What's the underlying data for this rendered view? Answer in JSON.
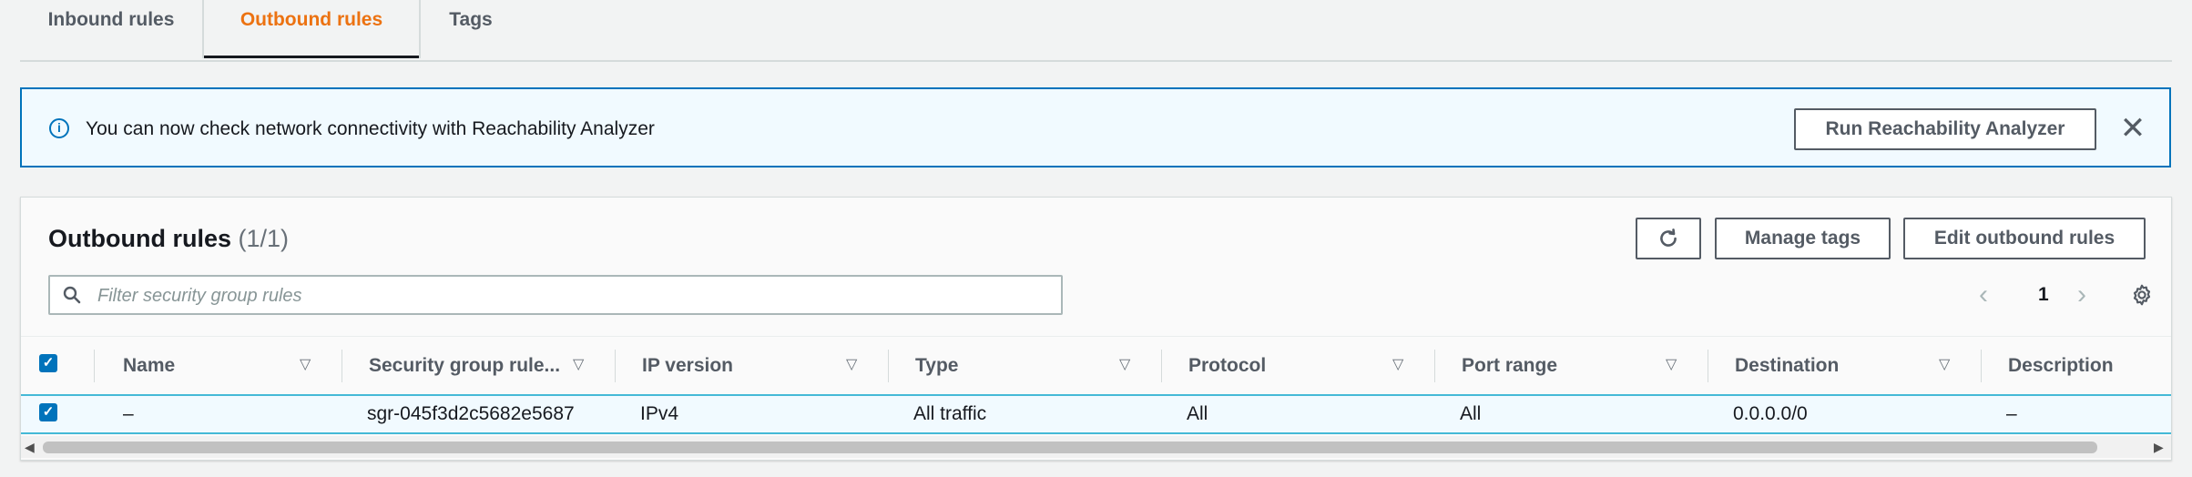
{
  "tabs": [
    {
      "label": "Inbound rules",
      "active": false
    },
    {
      "label": "Outbound rules",
      "active": true
    },
    {
      "label": "Tags",
      "active": false
    }
  ],
  "banner": {
    "icon": "info-icon",
    "text": "You can now check network connectivity with Reachability Analyzer",
    "button_label": "Run Reachability Analyzer",
    "close_glyph": "✕"
  },
  "panel": {
    "title": "Outbound rules",
    "count": "(1/1)",
    "refresh_icon": "refresh-icon",
    "manage_tags_label": "Manage tags",
    "edit_label": "Edit outbound rules",
    "search_placeholder": "Filter security group rules",
    "search_value": "",
    "page_current": "1"
  },
  "table": {
    "columns": [
      "Name",
      "Security group rule...",
      "IP version",
      "Type",
      "Protocol",
      "Port range",
      "Destination",
      "Description"
    ],
    "rows": [
      {
        "selected": true,
        "cells": [
          "–",
          "sgr-045f3d2c5682e5687",
          "IPv4",
          "All traffic",
          "All",
          "All",
          "0.0.0.0/0",
          "–"
        ]
      }
    ]
  },
  "colors": {
    "accent": "#ec7211",
    "link_blue": "#0073bb",
    "banner_bg": "#f1faff"
  }
}
